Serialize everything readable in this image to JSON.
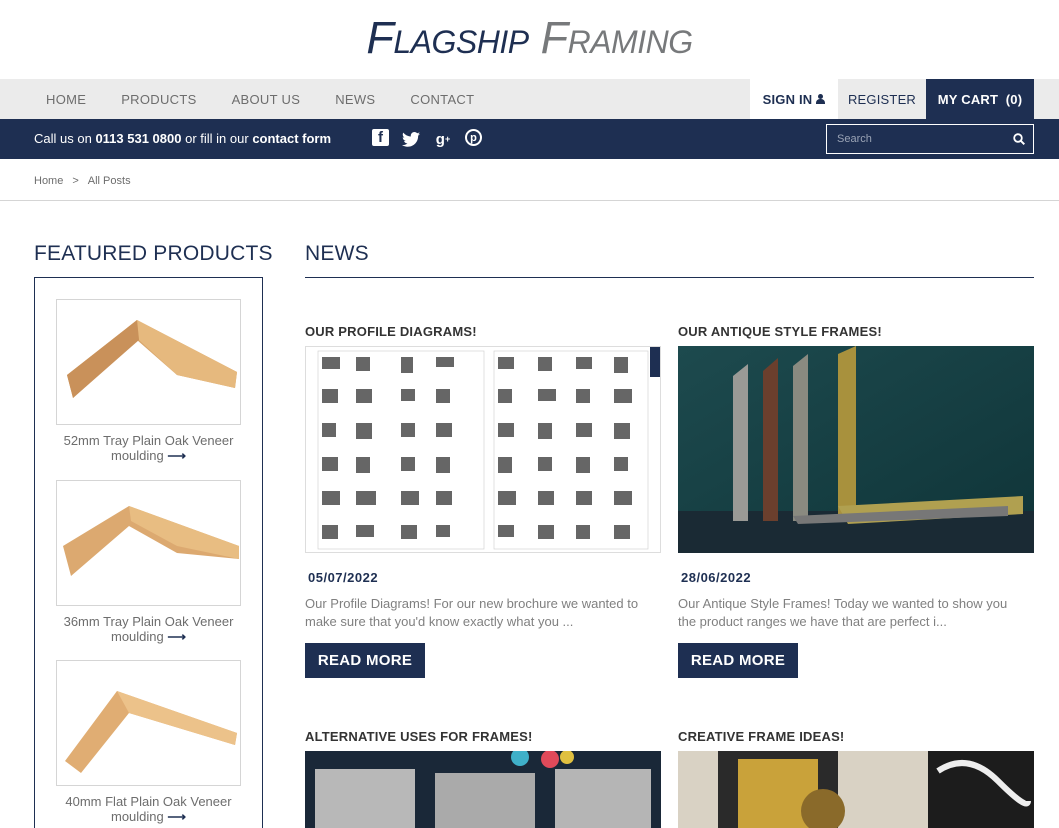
{
  "brand": {
    "word1": "Flagship",
    "word2": "Framing"
  },
  "nav": {
    "items": [
      "HOME",
      "PRODUCTS",
      "ABOUT US",
      "NEWS",
      "CONTACT"
    ]
  },
  "account": {
    "signin": "SIGN IN",
    "register": "REGISTER",
    "cart": "MY CART  (0)"
  },
  "contact_bar": {
    "prefix": "Call us on",
    "phone": "0113 531 0800",
    "middle": "or fill in our",
    "form_link": "contact form",
    "social": [
      "facebook-icon",
      "twitter-icon",
      "google-plus-icon",
      "pinterest-icon"
    ]
  },
  "search": {
    "placeholder": "Search"
  },
  "breadcrumb": {
    "home": "Home",
    "separator": ">",
    "current": "All Posts"
  },
  "sidebar": {
    "title": "FEATURED PRODUCTS",
    "products": [
      {
        "name": "52mm Tray Plain Oak Veneer moulding",
        "arrow": "⟶"
      },
      {
        "name": "36mm Tray Plain Oak Veneer moulding",
        "arrow": "⟶"
      },
      {
        "name": "40mm Flat Plain Oak Veneer moulding",
        "arrow": "⟶"
      }
    ]
  },
  "news": {
    "title": "NEWS",
    "posts": [
      {
        "title": "OUR PROFILE DIAGRAMS!",
        "date": "05/07/2022",
        "excerpt": "Our Profile Diagrams! For our new brochure we wanted to make sure that you'd know exactly what you ...",
        "button": "READ MORE"
      },
      {
        "title": "OUR ANTIQUE STYLE FRAMES!",
        "date": "28/06/2022",
        "excerpt": "Our Antique Style Frames! Today we wanted to show you the product ranges we have that are perfect i...",
        "button": "READ MORE"
      },
      {
        "title": "ALTERNATIVE USES FOR FRAMES!"
      },
      {
        "title": "CREATIVE FRAME IDEAS!"
      }
    ]
  },
  "colors": {
    "navy": "#1e2f52",
    "grey_nav": "#ebebeb",
    "text_grey": "#6d6d6d"
  }
}
